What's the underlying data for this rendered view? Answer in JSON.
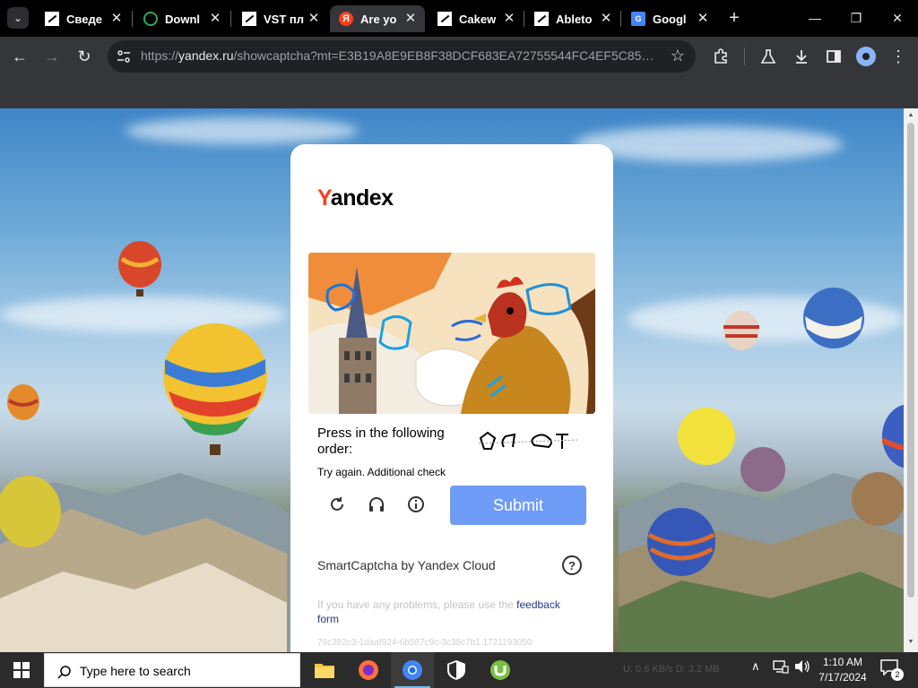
{
  "browser": {
    "tabs": [
      {
        "title": "Сведе",
        "favicon": "file-icon",
        "active": false
      },
      {
        "title": "Downl",
        "favicon": "download-icon",
        "active": false
      },
      {
        "title": "VST пл",
        "favicon": "file-icon",
        "active": false
      },
      {
        "title": "Are yo",
        "favicon": "yandex-icon",
        "active": true
      },
      {
        "title": "Cakew",
        "favicon": "file-icon",
        "active": false
      },
      {
        "title": "Ableto",
        "favicon": "file-icon",
        "active": false
      },
      {
        "title": "Googl",
        "favicon": "google-translate-icon",
        "active": false
      }
    ],
    "url_scheme": "https://",
    "url_host": "yandex.ru",
    "url_path": "/showcaptcha?mt=E3B19A8E9EB8F38DCF683EA72755544FC4EF5C854352C..."
  },
  "captcha": {
    "logo_y": "Y",
    "logo_rest": "andex",
    "prompt": "Press in the following order:",
    "error_text": "Try again. Additional check",
    "submit_label": "Submit",
    "brand_text": "SmartCaptcha by Yandex Cloud",
    "help_label": "?",
    "problems_text": "If you have any problems, please use the ",
    "problems_link": "feedback form",
    "request_id": "79c382c3-1daaf924-6b587c9c-3c38c7b1 1721193050",
    "accent_color": "#6f9cf6",
    "brand_color": "#fc3f1d"
  },
  "taskbar": {
    "search_placeholder": "Type here to search",
    "net_speed": "U: 0.6 KB/s  D: 3.2 MB",
    "time": "1:10 AM",
    "date": "7/17/2024",
    "notification_count": "2"
  }
}
